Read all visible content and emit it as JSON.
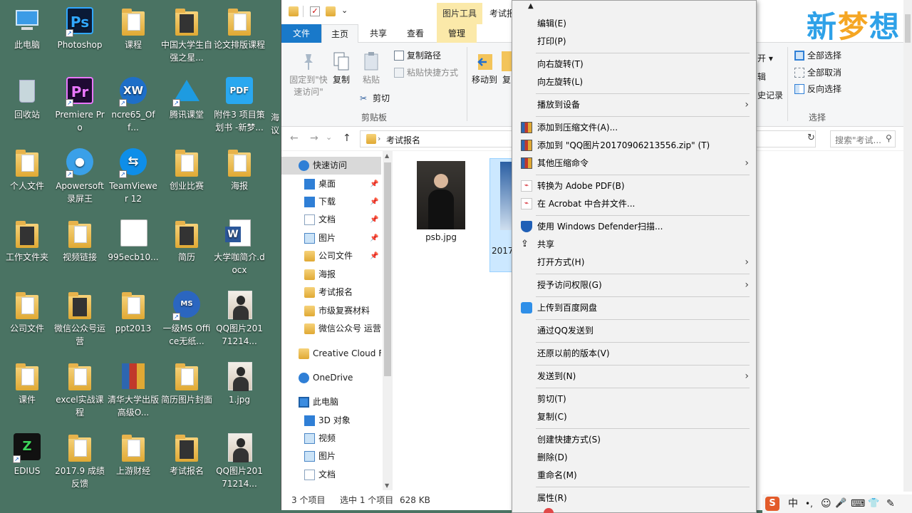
{
  "desktop": {
    "icons": [
      {
        "label": "此电脑",
        "glyph": "pc-icon",
        "shortcut": false
      },
      {
        "label": "Photoshop",
        "glyph": "photoshop-icon",
        "shortcut": true,
        "tile": "Ps",
        "color": "#0a1a36",
        "fg": "#31a8ff"
      },
      {
        "label": "课程",
        "glyph": "folder-icon",
        "shortcut": false
      },
      {
        "label": "中国大学生自强之星...",
        "glyph": "folder-icon",
        "shortcut": false
      },
      {
        "label": "论文排版课程",
        "glyph": "folder-icon",
        "shortcut": false
      },
      {
        "label": "回收站",
        "glyph": "recycle-bin-icon",
        "shortcut": false
      },
      {
        "label": "Premiere Pro",
        "glyph": "premiere-icon",
        "shortcut": true,
        "tile": "Pr",
        "color": "#1f0a33",
        "fg": "#ea77ff"
      },
      {
        "label": "ncre65_Off...",
        "glyph": "ncre-icon",
        "shortcut": true
      },
      {
        "label": "腾讯课堂",
        "glyph": "tencent-classroom-icon",
        "shortcut": true
      },
      {
        "label": "附件3 项目策划书 -新梦...",
        "glyph": "pdf-icon",
        "shortcut": false
      },
      {
        "label": "个人文件",
        "glyph": "folder-icon",
        "shortcut": false
      },
      {
        "label": "Apowersoft录屏王",
        "glyph": "apowersoft-icon",
        "shortcut": true
      },
      {
        "label": "TeamViewer 12",
        "glyph": "teamviewer-icon",
        "shortcut": true
      },
      {
        "label": "创业比赛",
        "glyph": "folder-icon",
        "shortcut": false
      },
      {
        "label": "海报",
        "glyph": "folder-icon",
        "shortcut": false
      },
      {
        "label": "工作文件夹",
        "glyph": "folder-icon",
        "shortcut": false
      },
      {
        "label": "视频链接",
        "glyph": "folder-icon",
        "shortcut": false
      },
      {
        "label": "995ecb10...",
        "glyph": "image-file-icon",
        "shortcut": false
      },
      {
        "label": "简历",
        "glyph": "folder-icon",
        "shortcut": false
      },
      {
        "label": "大学咖简介.docx",
        "glyph": "word-doc-icon",
        "shortcut": false
      },
      {
        "label": "公司文件",
        "glyph": "folder-icon",
        "shortcut": false
      },
      {
        "label": "微信公众号运营",
        "glyph": "folder-icon",
        "shortcut": false
      },
      {
        "label": "ppt2013",
        "glyph": "folder-icon",
        "shortcut": false
      },
      {
        "label": "一级MS Office无纸...",
        "glyph": "ms-office-exam-icon",
        "shortcut": true
      },
      {
        "label": "QQ图片20171214...",
        "glyph": "photo-icon",
        "shortcut": false
      },
      {
        "label": "课件",
        "glyph": "folder-icon",
        "shortcut": false
      },
      {
        "label": "excel实战课程",
        "glyph": "folder-icon",
        "shortcut": false
      },
      {
        "label": "清华大学出版 高级O...",
        "glyph": "winrar-icon",
        "shortcut": false
      },
      {
        "label": "简历图片封面",
        "glyph": "folder-icon",
        "shortcut": false
      },
      {
        "label": "1.jpg",
        "glyph": "photo-icon",
        "shortcut": false
      },
      {
        "label": "EDIUS",
        "glyph": "edius-icon",
        "shortcut": true
      },
      {
        "label": "2017.9 成绩反馈",
        "glyph": "folder-icon",
        "shortcut": false
      },
      {
        "label": "上游财经",
        "glyph": "folder-icon",
        "shortcut": false
      },
      {
        "label": "考试报名",
        "glyph": "folder-icon",
        "shortcut": false
      },
      {
        "label": "QQ图片20171214...",
        "glyph": "photo-icon",
        "shortcut": false
      }
    ],
    "partial_column": [
      {
        "label": "海"
      },
      {
        "label": "议"
      }
    ]
  },
  "explorer": {
    "title": "考试报",
    "tool_tab": "图片工具",
    "tabs": {
      "file": "文件",
      "home": "主页",
      "share": "共享",
      "view": "查看",
      "manage": "管理"
    },
    "ribbon": {
      "pin": "固定到\"快速访问\"",
      "copy": "复制",
      "paste": "粘贴",
      "copy_path": "复制路径",
      "paste_shortcut": "粘贴快捷方式",
      "cut": "剪切",
      "clipboard_group": "剪贴板",
      "move_to": "移动到",
      "copy_to_partial": "复",
      "open_partial": "开 ▾",
      "edit_partial": "辑",
      "history_partial": "史记录",
      "select_all": "全部选择",
      "select_none": "全部取消",
      "invert": "反向选择",
      "select_group": "选择"
    },
    "address": {
      "path": "考试报名",
      "search_placeholder": "搜索\"考试...",
      "back": "←",
      "forward": "→",
      "up": "↑",
      "dropdown": "⌄",
      "refresh": "↻"
    },
    "nav": [
      {
        "label": "快速访问",
        "icon": "star-icon",
        "indent": 0,
        "pin": false,
        "selected": true
      },
      {
        "label": "桌面",
        "icon": "desktop-icon",
        "indent": 1,
        "pin": true
      },
      {
        "label": "下载",
        "icon": "download-icon",
        "indent": 1,
        "pin": true
      },
      {
        "label": "文档",
        "icon": "document-icon",
        "indent": 1,
        "pin": true
      },
      {
        "label": "图片",
        "icon": "picture-icon",
        "indent": 1,
        "pin": true
      },
      {
        "label": "公司文件",
        "icon": "folder-icon",
        "indent": 1,
        "pin": true
      },
      {
        "label": "海报",
        "icon": "folder-icon",
        "indent": 1,
        "pin": false
      },
      {
        "label": "考试报名",
        "icon": "folder-icon",
        "indent": 1,
        "pin": false
      },
      {
        "label": "市级复赛材料",
        "icon": "folder-icon",
        "indent": 1,
        "pin": false
      },
      {
        "label": "微信公众号 运营",
        "icon": "folder-icon",
        "indent": 1,
        "pin": false
      },
      {
        "label": "Creative Cloud F",
        "icon": "creative-cloud-icon",
        "indent": 0,
        "pin": false
      },
      {
        "label": "OneDrive",
        "icon": "onedrive-icon",
        "indent": 0,
        "pin": false
      },
      {
        "label": "此电脑",
        "icon": "pc-icon",
        "indent": 0,
        "pin": false
      },
      {
        "label": "3D 对象",
        "icon": "3d-objects-icon",
        "indent": 1,
        "pin": false
      },
      {
        "label": "视频",
        "icon": "video-icon",
        "indent": 1,
        "pin": false
      },
      {
        "label": "图片",
        "icon": "picture-icon",
        "indent": 1,
        "pin": false
      },
      {
        "label": "文档",
        "icon": "document-icon",
        "indent": 1,
        "pin": false
      }
    ],
    "files": [
      {
        "name": "psb.jpg",
        "selected": false
      },
      {
        "name": "2017",
        "selected": true
      }
    ],
    "status": {
      "count": "3 个项目",
      "selected": "选中 1 个项目",
      "size": "628 KB"
    }
  },
  "context_menu": {
    "items": [
      {
        "type": "item",
        "label": "编辑(E)"
      },
      {
        "type": "item",
        "label": "打印(P)"
      },
      {
        "type": "sep"
      },
      {
        "type": "item",
        "label": "向右旋转(T)"
      },
      {
        "type": "item",
        "label": "向左旋转(L)"
      },
      {
        "type": "sep"
      },
      {
        "type": "item",
        "label": "播放到设备",
        "submenu": true
      },
      {
        "type": "sep"
      },
      {
        "type": "item",
        "label": "添加到压缩文件(A)...",
        "icon": "winrar-icon"
      },
      {
        "type": "item",
        "label": "添加到 \"QQ图片20170906213556.zip\" (T)",
        "icon": "winrar-icon"
      },
      {
        "type": "item",
        "label": "其他压缩命令",
        "icon": "winrar-icon",
        "submenu": true
      },
      {
        "type": "sep"
      },
      {
        "type": "item",
        "label": "转换为 Adobe PDF(B)",
        "icon": "adobe-pdf-icon"
      },
      {
        "type": "item",
        "label": "在 Acrobat 中合并文件...",
        "icon": "adobe-pdf-icon"
      },
      {
        "type": "sep"
      },
      {
        "type": "item",
        "label": "使用 Windows Defender扫描...",
        "icon": "defender-shield-icon"
      },
      {
        "type": "item",
        "label": "共享",
        "icon": "share-icon"
      },
      {
        "type": "item",
        "label": "打开方式(H)",
        "submenu": true
      },
      {
        "type": "sep"
      },
      {
        "type": "item",
        "label": "授予访问权限(G)",
        "submenu": true
      },
      {
        "type": "sep"
      },
      {
        "type": "item",
        "label": "上传到百度网盘",
        "icon": "baidu-netdisk-icon"
      },
      {
        "type": "sep"
      },
      {
        "type": "item",
        "label": "通过QQ发送到"
      },
      {
        "type": "sep"
      },
      {
        "type": "item",
        "label": "还原以前的版本(V)"
      },
      {
        "type": "sep"
      },
      {
        "type": "item",
        "label": "发送到(N)",
        "submenu": true
      },
      {
        "type": "sep"
      },
      {
        "type": "item",
        "label": "剪切(T)"
      },
      {
        "type": "item",
        "label": "复制(C)"
      },
      {
        "type": "sep"
      },
      {
        "type": "item",
        "label": "创建快捷方式(S)"
      },
      {
        "type": "item",
        "label": "删除(D)"
      },
      {
        "type": "item",
        "label": "重命名(M)"
      },
      {
        "type": "sep"
      },
      {
        "type": "item",
        "label": "属性(R)"
      }
    ]
  },
  "watermark": {
    "c1": "新",
    "c2": "梦",
    "c3": "想"
  },
  "tray": {
    "ime_logo": "S",
    "ime_mode": "中",
    "punct": "•,",
    "emoji": "☺",
    "mic": "🎤",
    "keyboard": "⌨",
    "skin": "👕",
    "tools": "✎"
  }
}
